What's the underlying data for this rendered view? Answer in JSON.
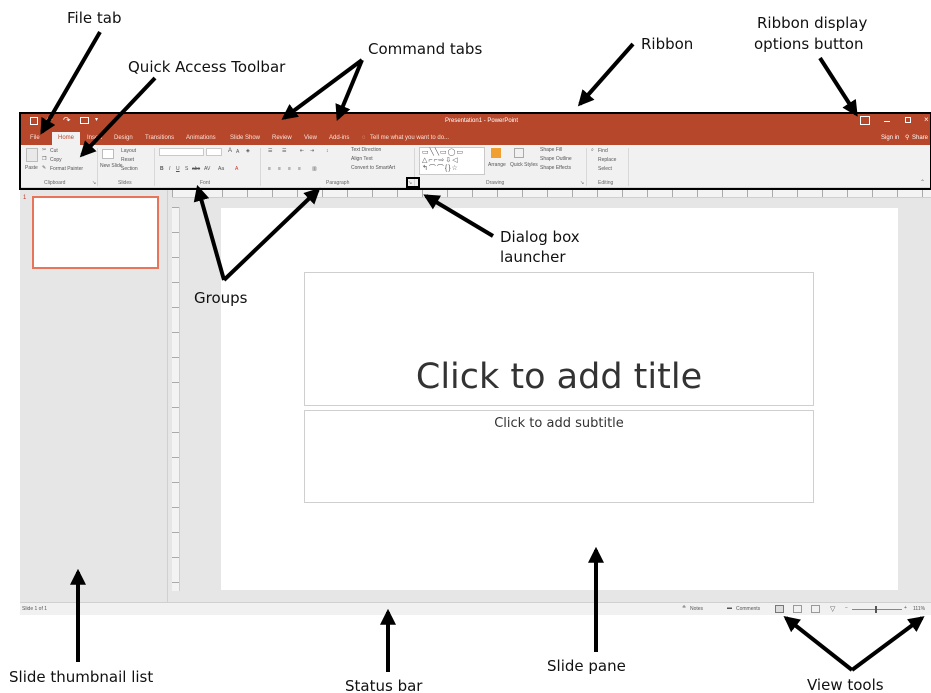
{
  "annotations": {
    "file_tab": "File tab",
    "quick_access": "Quick Access Toolbar",
    "command_tabs": "Command tabs",
    "ribbon": "Ribbon",
    "ribbon_display_1": "Ribbon display",
    "ribbon_display_2": "options button",
    "dialog_launcher_1": "Dialog box",
    "dialog_launcher_2": "launcher",
    "groups": "Groups",
    "thumbnail_list": "Slide thumbnail list",
    "status_bar": "Status bar",
    "slide_pane": "Slide pane",
    "view_tools": "View tools"
  },
  "window": {
    "title": "Presentation1 - PowerPoint",
    "sign_in": "Sign in",
    "share": "Share"
  },
  "tabs": [
    {
      "label": "File"
    },
    {
      "label": "Home"
    },
    {
      "label": "Insert"
    },
    {
      "label": "Design"
    },
    {
      "label": "Transitions"
    },
    {
      "label": "Animations"
    },
    {
      "label": "Slide Show"
    },
    {
      "label": "Review"
    },
    {
      "label": "View"
    },
    {
      "label": "Add-ins"
    }
  ],
  "tell_me": "Tell me what you want to do...",
  "ribbon": {
    "clipboard": {
      "label": "Clipboard",
      "paste": "Paste",
      "cut": "Cut",
      "copy": "Copy",
      "format_painter": "Format Painter"
    },
    "slides": {
      "label": "Slides",
      "new_slide": "New Slide",
      "layout": "Layout",
      "reset": "Reset",
      "section": "Section"
    },
    "font": {
      "label": "Font"
    },
    "paragraph": {
      "label": "Paragraph",
      "text_direction": "Text Direction",
      "align_text": "Align Text",
      "convert_smartart": "Convert to SmartArt"
    },
    "drawing": {
      "label": "Drawing",
      "arrange": "Arrange",
      "quick_styles": "Quick Styles",
      "shape_fill": "Shape Fill",
      "shape_outline": "Shape Outline",
      "shape_effects": "Shape Effects"
    },
    "editing": {
      "label": "Editing",
      "find": "Find",
      "replace": "Replace",
      "select": "Select"
    }
  },
  "thumbnail": {
    "number": "1"
  },
  "slide": {
    "title_placeholder": "Click to add title",
    "subtitle_placeholder": "Click to add subtitle"
  },
  "status": {
    "slide_count": "Slide 1 of 1",
    "notes": "Notes",
    "comments": "Comments",
    "zoom": "111%"
  },
  "colors": {
    "accent": "#b7472a",
    "ribbon_bg": "#f1f1f1",
    "workspace_bg": "#e6e6e6",
    "thumbnail_border": "#e8755a"
  }
}
